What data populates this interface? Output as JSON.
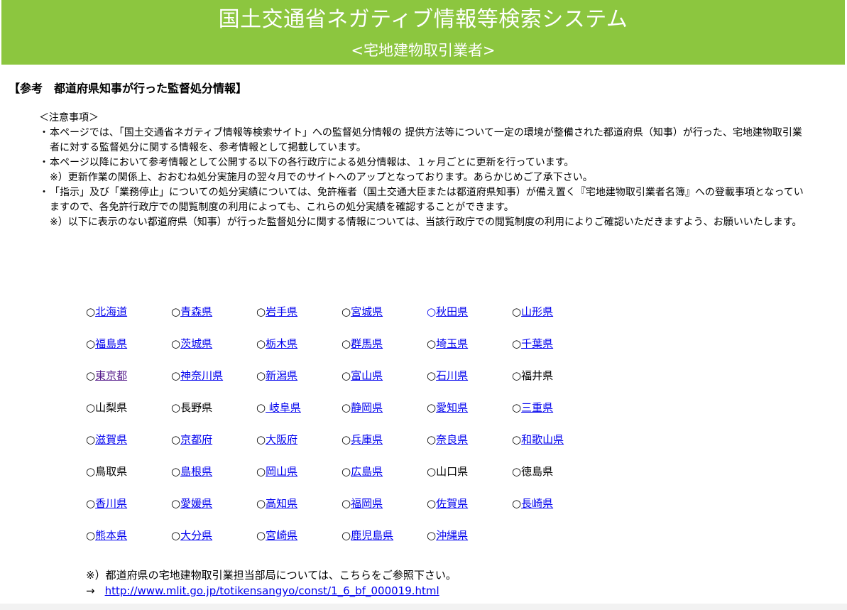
{
  "header": {
    "title": "国土交通省ネガティブ情報等検索システム",
    "subtitle": "<宅地建物取引業者>",
    "bg_color": "#8cc63f"
  },
  "section_heading": "【参考　都道府県知事が行った監督処分情報】",
  "notes": {
    "title": "＜注意事項＞",
    "items": [
      {
        "bullet": "・",
        "lines": [
          "本ページでは、「国土交通省ネガティブ情報等検索サイト」への監督処分情報の 提供方法等について一定の環境が整備された都道府県（知事）が行った、宅地建物取引業者に対する監督処分に関する情報を、参考情報として掲載しています。"
        ]
      },
      {
        "bullet": "・",
        "lines": [
          "本ページ以降において参考情報として公開する以下の各行政庁による処分情報は、１ヶ月ごとに更新を行っています。",
          "※）更新作業の関係上、おおむね処分実施月の翌々月でのサイトへのアップとなっております。あらかじめご了承下さい。"
        ]
      },
      {
        "bullet": "・",
        "lines": [
          "「指示」及び「業務停止」についての処分実績については、免許権者（国土交通大臣または都道府県知事）が備え置く『宅地建物取引業者名簿』への登載事項となっていますので、各免許行政庁での閲覧制度の利用によっても、これらの処分実績を確認することができます。",
          "※）以下に表示のない都道府県（知事）が行った監督処分に関する情報については、当該行政庁での閲覧制度の利用によりご確認いただきますよう、お願いいたします。"
        ]
      }
    ]
  },
  "prefecture_grid": {
    "mark": "○",
    "rows": [
      [
        {
          "name": "北海道",
          "link": true
        },
        {
          "name": "青森県",
          "link": true
        },
        {
          "name": "岩手県",
          "link": true
        },
        {
          "name": "宮城県",
          "link": true
        },
        {
          "name": "秋田県",
          "link": true,
          "mark_linked": true
        },
        {
          "name": "山形県",
          "link": true
        }
      ],
      [
        {
          "name": "福島県",
          "link": true
        },
        {
          "name": "茨城県",
          "link": true
        },
        {
          "name": "栃木県",
          "link": true
        },
        {
          "name": "群馬県",
          "link": true
        },
        {
          "name": "埼玉県",
          "link": true
        },
        {
          "name": "千葉県",
          "link": true
        }
      ],
      [
        {
          "name": "東京都",
          "link": true,
          "visited": true
        },
        {
          "name": "神奈川県",
          "link": true
        },
        {
          "name": "新潟県",
          "link": true
        },
        {
          "name": "富山県",
          "link": true
        },
        {
          "name": "石川県",
          "link": true
        },
        {
          "name": "福井県",
          "link": false
        }
      ],
      [
        {
          "name": "山梨県",
          "link": false
        },
        {
          "name": "長野県",
          "link": false
        },
        {
          "name": " 岐阜県",
          "link": true
        },
        {
          "name": "静岡県",
          "link": true
        },
        {
          "name": "愛知県",
          "link": true
        },
        {
          "name": "三重県",
          "link": true
        }
      ],
      [
        {
          "name": "滋賀県",
          "link": true
        },
        {
          "name": "京都府",
          "link": true
        },
        {
          "name": "大阪府",
          "link": true
        },
        {
          "name": "兵庫県",
          "link": true
        },
        {
          "name": "奈良県",
          "link": true
        },
        {
          "name": "和歌山県",
          "link": true
        }
      ],
      [
        {
          "name": "鳥取県",
          "link": false
        },
        {
          "name": "島根県",
          "link": true
        },
        {
          "name": "岡山県",
          "link": true
        },
        {
          "name": "広島県",
          "link": true
        },
        {
          "name": "山口県",
          "link": false
        },
        {
          "name": "徳島県",
          "link": false
        }
      ],
      [
        {
          "name": "香川県",
          "link": true
        },
        {
          "name": "愛媛県",
          "link": true
        },
        {
          "name": "高知県",
          "link": true
        },
        {
          "name": "福岡県",
          "link": true
        },
        {
          "name": "佐賀県",
          "link": true
        },
        {
          "name": "長崎県",
          "link": true
        }
      ],
      [
        {
          "name": "熊本県",
          "link": true
        },
        {
          "name": "大分県",
          "link": true
        },
        {
          "name": "宮崎県",
          "link": true
        },
        {
          "name": "鹿児島県",
          "link": true
        },
        {
          "name": "沖縄県",
          "link": true
        }
      ]
    ]
  },
  "footer": {
    "note": "※）都道府県の宅地建物取引業担当部局については、こちらをご参照下さい。",
    "arrow": "→",
    "link_text": "http://www.mlit.go.jp/totikensangyo/const/1_6_bf_000019.html"
  },
  "colors": {
    "link": "#0000ee",
    "visited_link": "#551a8b",
    "banner": "#8cc63f"
  }
}
